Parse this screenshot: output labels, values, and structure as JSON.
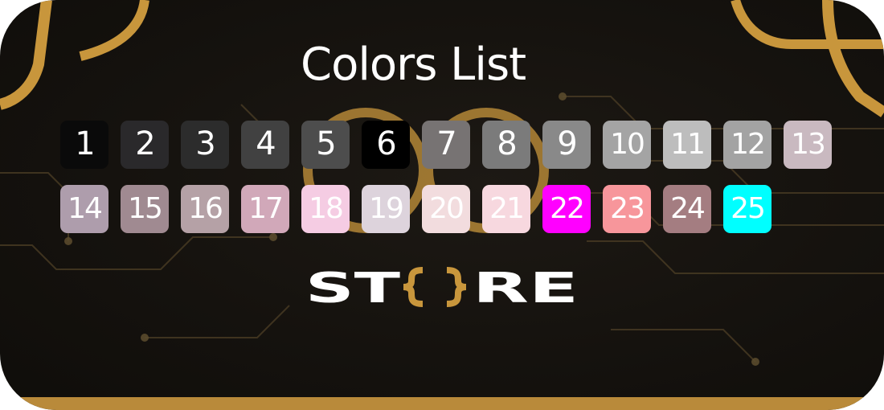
{
  "title": "Colors List",
  "colors": [
    {
      "label": "1",
      "color": "#0a0a0a"
    },
    {
      "label": "2",
      "color": "#2a292b"
    },
    {
      "label": "3",
      "color": "#2c2c2c"
    },
    {
      "label": "4",
      "color": "#414141"
    },
    {
      "label": "5",
      "color": "#4d4d4d"
    },
    {
      "label": "6",
      "color": "#000000"
    },
    {
      "label": "7",
      "color": "#777373"
    },
    {
      "label": "8",
      "color": "#7b7b7b"
    },
    {
      "label": "9",
      "color": "#898989"
    },
    {
      "label": "10",
      "color": "#a4a4a4"
    },
    {
      "label": "11",
      "color": "#bdbdbd"
    },
    {
      "label": "12",
      "color": "#a3a3a3"
    },
    {
      "label": "13",
      "color": "#c9b9c0"
    },
    {
      "label": "14",
      "color": "#ae9dac"
    },
    {
      "label": "15",
      "color": "#a08a91"
    },
    {
      "label": "16",
      "color": "#b5a1a6"
    },
    {
      "label": "17",
      "color": "#d1a8b9"
    },
    {
      "label": "18",
      "color": "#f5cce3"
    },
    {
      "label": "19",
      "color": "#ddd3dc"
    },
    {
      "label": "20",
      "color": "#f2dcde"
    },
    {
      "label": "21",
      "color": "#f7d8df"
    },
    {
      "label": "22",
      "color": "#ff00ff"
    },
    {
      "label": "23",
      "color": "#f7969b"
    },
    {
      "label": "24",
      "color": "#a47d81"
    },
    {
      "label": "25",
      "color": "#00ffff"
    }
  ],
  "logo": {
    "text": "ST{}RE",
    "text_color": "#ffffff",
    "accent_color": "#c8963c"
  },
  "theme": {
    "accent": "#c8963c",
    "background": "#15120e"
  }
}
